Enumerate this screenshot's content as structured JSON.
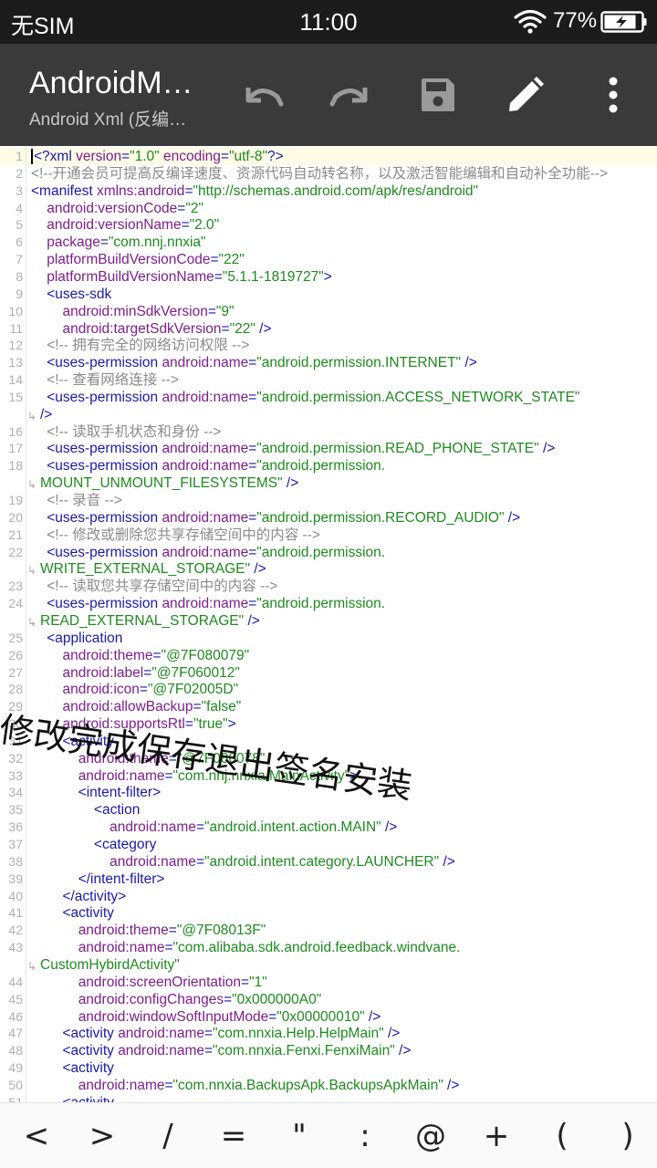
{
  "status_bar": {
    "carrier": "无SIM",
    "time": "11:00",
    "battery_percent": "77%"
  },
  "toolbar": {
    "title": "AndroidM…",
    "subtitle": "Android Xml (反编…",
    "icons": [
      "undo-icon",
      "redo-icon",
      "save-icon",
      "edit-icon",
      "more-icon"
    ]
  },
  "editor": {
    "lines": [
      {
        "n": "1",
        "segs": [
          [
            "t",
            "<?xml "
          ],
          [
            "a",
            "version"
          ],
          [
            "t",
            "="
          ],
          [
            "v",
            "\"1.0\""
          ],
          [
            "t",
            " "
          ],
          [
            "a",
            "encoding"
          ],
          [
            "t",
            "="
          ],
          [
            "v",
            "\"utf-8\""
          ],
          [
            "t",
            "?>"
          ]
        ]
      },
      {
        "n": "2",
        "segs": [
          [
            "c",
            "<!--开通会员可提高反编译速度、资源代码自动转名称，以及激活智能编辑和自动补全功能-->"
          ]
        ]
      },
      {
        "n": "3",
        "segs": [
          [
            "t",
            "<manifest "
          ],
          [
            "a",
            "xmlns:android"
          ],
          [
            "t",
            "="
          ],
          [
            "v",
            "\"http://schemas.android.com/apk/res/android\""
          ]
        ]
      },
      {
        "n": "4",
        "segs": [
          [
            "t",
            "    "
          ],
          [
            "a",
            "android:versionCode"
          ],
          [
            "t",
            "="
          ],
          [
            "v",
            "\"2\""
          ]
        ]
      },
      {
        "n": "5",
        "segs": [
          [
            "t",
            "    "
          ],
          [
            "a",
            "android:versionName"
          ],
          [
            "t",
            "="
          ],
          [
            "v",
            "\"2.0\""
          ]
        ]
      },
      {
        "n": "6",
        "segs": [
          [
            "t",
            "    "
          ],
          [
            "a",
            "package"
          ],
          [
            "t",
            "="
          ],
          [
            "v",
            "\"com.nnj.nnxia\""
          ]
        ]
      },
      {
        "n": "7",
        "segs": [
          [
            "t",
            "    "
          ],
          [
            "a",
            "platformBuildVersionCode"
          ],
          [
            "t",
            "="
          ],
          [
            "v",
            "\"22\""
          ]
        ]
      },
      {
        "n": "8",
        "segs": [
          [
            "t",
            "    "
          ],
          [
            "a",
            "platformBuildVersionName"
          ],
          [
            "t",
            "="
          ],
          [
            "v",
            "\"5.1.1-1819727\""
          ],
          [
            "t",
            ">"
          ]
        ]
      },
      {
        "n": "9",
        "segs": [
          [
            "t",
            "    <uses-sdk"
          ]
        ]
      },
      {
        "n": "10",
        "segs": [
          [
            "t",
            "        "
          ],
          [
            "a",
            "android:minSdkVersion"
          ],
          [
            "t",
            "="
          ],
          [
            "v",
            "\"9\""
          ]
        ]
      },
      {
        "n": "11",
        "segs": [
          [
            "t",
            "        "
          ],
          [
            "a",
            "android:targetSdkVersion"
          ],
          [
            "t",
            "="
          ],
          [
            "v",
            "\"22\""
          ],
          [
            "t",
            " />"
          ]
        ]
      },
      {
        "n": "12",
        "segs": [
          [
            "t",
            "    "
          ],
          [
            "c",
            "<!-- 拥有完全的网络访问权限 -->"
          ]
        ]
      },
      {
        "n": "13",
        "segs": [
          [
            "t",
            "    <uses-permission "
          ],
          [
            "a",
            "android:name"
          ],
          [
            "t",
            "="
          ],
          [
            "v",
            "\"android.permission.INTERNET\""
          ],
          [
            "t",
            " />"
          ]
        ]
      },
      {
        "n": "14",
        "segs": [
          [
            "t",
            "    "
          ],
          [
            "c",
            "<!-- 查看网络连接 -->"
          ]
        ]
      },
      {
        "n": "15",
        "segs": [
          [
            "t",
            "    <uses-permission "
          ],
          [
            "a",
            "android:name"
          ],
          [
            "t",
            "="
          ],
          [
            "v",
            "\"android.permission.ACCESS_NETWORK_STATE\""
          ]
        ]
      },
      {
        "n": "",
        "wrap": true,
        "segs": [
          [
            "t",
            "/>"
          ]
        ]
      },
      {
        "n": "16",
        "segs": [
          [
            "t",
            "    "
          ],
          [
            "c",
            "<!-- 读取手机状态和身份 -->"
          ]
        ]
      },
      {
        "n": "17",
        "segs": [
          [
            "t",
            "    <uses-permission "
          ],
          [
            "a",
            "android:name"
          ],
          [
            "t",
            "="
          ],
          [
            "v",
            "\"android.permission.READ_PHONE_STATE\""
          ],
          [
            "t",
            " />"
          ]
        ]
      },
      {
        "n": "18",
        "segs": [
          [
            "t",
            "    <uses-permission "
          ],
          [
            "a",
            "android:name"
          ],
          [
            "t",
            "="
          ],
          [
            "v",
            "\"android.permission."
          ]
        ]
      },
      {
        "n": "",
        "wrap": true,
        "segs": [
          [
            "v",
            "MOUNT_UNMOUNT_FILESYSTEMS\""
          ],
          [
            "t",
            " />"
          ]
        ]
      },
      {
        "n": "19",
        "segs": [
          [
            "t",
            "    "
          ],
          [
            "c",
            "<!-- 录音 -->"
          ]
        ]
      },
      {
        "n": "20",
        "segs": [
          [
            "t",
            "    <uses-permission "
          ],
          [
            "a",
            "android:name"
          ],
          [
            "t",
            "="
          ],
          [
            "v",
            "\"android.permission.RECORD_AUDIO\""
          ],
          [
            "t",
            " />"
          ]
        ]
      },
      {
        "n": "21",
        "segs": [
          [
            "t",
            "    "
          ],
          [
            "c",
            "<!-- 修改或删除您共享存储空间中的内容 -->"
          ]
        ]
      },
      {
        "n": "22",
        "segs": [
          [
            "t",
            "    <uses-permission "
          ],
          [
            "a",
            "android:name"
          ],
          [
            "t",
            "="
          ],
          [
            "v",
            "\"android.permission."
          ]
        ]
      },
      {
        "n": "",
        "wrap": true,
        "segs": [
          [
            "v",
            "WRITE_EXTERNAL_STORAGE\""
          ],
          [
            "t",
            " />"
          ]
        ]
      },
      {
        "n": "23",
        "segs": [
          [
            "t",
            "    "
          ],
          [
            "c",
            "<!-- 读取您共享存储空间中的内容 -->"
          ]
        ]
      },
      {
        "n": "24",
        "segs": [
          [
            "t",
            "    <uses-permission "
          ],
          [
            "a",
            "android:name"
          ],
          [
            "t",
            "="
          ],
          [
            "v",
            "\"android.permission."
          ]
        ]
      },
      {
        "n": "",
        "wrap": true,
        "segs": [
          [
            "v",
            "READ_EXTERNAL_STORAGE\""
          ],
          [
            "t",
            " />"
          ]
        ]
      },
      {
        "n": "25",
        "segs": [
          [
            "t",
            "    <application"
          ]
        ]
      },
      {
        "n": "26",
        "segs": [
          [
            "t",
            "        "
          ],
          [
            "a",
            "android:theme"
          ],
          [
            "t",
            "="
          ],
          [
            "v",
            "\"@7F080079\""
          ]
        ]
      },
      {
        "n": "27",
        "segs": [
          [
            "t",
            "        "
          ],
          [
            "a",
            "android:label"
          ],
          [
            "t",
            "="
          ],
          [
            "v",
            "\"@7F060012\""
          ]
        ]
      },
      {
        "n": "28",
        "segs": [
          [
            "t",
            "        "
          ],
          [
            "a",
            "android:icon"
          ],
          [
            "t",
            "="
          ],
          [
            "v",
            "\"@7F02005D\""
          ]
        ]
      },
      {
        "n": "29",
        "segs": [
          [
            "t",
            "        "
          ],
          [
            "a",
            "android:allowBackup"
          ],
          [
            "t",
            "="
          ],
          [
            "v",
            "\"false\""
          ]
        ]
      },
      {
        "n": "30",
        "segs": [
          [
            "t",
            "        "
          ],
          [
            "a",
            "android:supportsRtl"
          ],
          [
            "t",
            "="
          ],
          [
            "v",
            "\"true\""
          ],
          [
            "t",
            ">"
          ]
        ]
      },
      {
        "n": "31",
        "segs": [
          [
            "t",
            "        <activity"
          ]
        ]
      },
      {
        "n": "32",
        "segs": [
          [
            "t",
            "            "
          ],
          [
            "a",
            "android:theme"
          ],
          [
            "t",
            "="
          ],
          [
            "v",
            "\"@7F080078\""
          ]
        ]
      },
      {
        "n": "33",
        "segs": [
          [
            "t",
            "            "
          ],
          [
            "a",
            "android:name"
          ],
          [
            "t",
            "="
          ],
          [
            "v",
            "\"com.nnj.nnxia.MainActivity\""
          ],
          [
            "t",
            ">"
          ]
        ]
      },
      {
        "n": "34",
        "segs": [
          [
            "t",
            "            <intent-filter>"
          ]
        ]
      },
      {
        "n": "35",
        "segs": [
          [
            "t",
            "                <action"
          ]
        ]
      },
      {
        "n": "36",
        "segs": [
          [
            "t",
            "                    "
          ],
          [
            "a",
            "android:name"
          ],
          [
            "t",
            "="
          ],
          [
            "v",
            "\"android.intent.action.MAIN\""
          ],
          [
            "t",
            " />"
          ]
        ]
      },
      {
        "n": "37",
        "segs": [
          [
            "t",
            "                <category"
          ]
        ]
      },
      {
        "n": "38",
        "segs": [
          [
            "t",
            "                    "
          ],
          [
            "a",
            "android:name"
          ],
          [
            "t",
            "="
          ],
          [
            "v",
            "\"android.intent.category.LAUNCHER\""
          ],
          [
            "t",
            " />"
          ]
        ]
      },
      {
        "n": "39",
        "segs": [
          [
            "t",
            "            </intent-filter>"
          ]
        ]
      },
      {
        "n": "40",
        "segs": [
          [
            "t",
            "        </activity>"
          ]
        ]
      },
      {
        "n": "41",
        "segs": [
          [
            "t",
            "        <activity"
          ]
        ]
      },
      {
        "n": "42",
        "segs": [
          [
            "t",
            "            "
          ],
          [
            "a",
            "android:theme"
          ],
          [
            "t",
            "="
          ],
          [
            "v",
            "\"@7F08013F\""
          ]
        ]
      },
      {
        "n": "43",
        "segs": [
          [
            "t",
            "            "
          ],
          [
            "a",
            "android:name"
          ],
          [
            "t",
            "="
          ],
          [
            "v",
            "\"com.alibaba.sdk.android.feedback.windvane."
          ]
        ]
      },
      {
        "n": "",
        "wrap": true,
        "segs": [
          [
            "v",
            "CustomHybirdActivity\""
          ]
        ]
      },
      {
        "n": "44",
        "segs": [
          [
            "t",
            "            "
          ],
          [
            "a",
            "android:screenOrientation"
          ],
          [
            "t",
            "="
          ],
          [
            "v",
            "\"1\""
          ]
        ]
      },
      {
        "n": "45",
        "segs": [
          [
            "t",
            "            "
          ],
          [
            "a",
            "android:configChanges"
          ],
          [
            "t",
            "="
          ],
          [
            "v",
            "\"0x000000A0\""
          ]
        ]
      },
      {
        "n": "46",
        "segs": [
          [
            "t",
            "            "
          ],
          [
            "a",
            "android:windowSoftInputMode"
          ],
          [
            "t",
            "="
          ],
          [
            "v",
            "\"0x00000010\""
          ],
          [
            "t",
            " />"
          ]
        ]
      },
      {
        "n": "47",
        "segs": [
          [
            "t",
            "        <activity "
          ],
          [
            "a",
            "android:name"
          ],
          [
            "t",
            "="
          ],
          [
            "v",
            "\"com.nnxia.Help.HelpMain\""
          ],
          [
            "t",
            " />"
          ]
        ]
      },
      {
        "n": "48",
        "segs": [
          [
            "t",
            "        <activity "
          ],
          [
            "a",
            "android:name"
          ],
          [
            "t",
            "="
          ],
          [
            "v",
            "\"com.nnxia.Fenxi.FenxiMain\""
          ],
          [
            "t",
            " />"
          ]
        ]
      },
      {
        "n": "49",
        "segs": [
          [
            "t",
            "        <activity"
          ]
        ]
      },
      {
        "n": "50",
        "segs": [
          [
            "t",
            "            "
          ],
          [
            "a",
            "android:name"
          ],
          [
            "t",
            "="
          ],
          [
            "v",
            "\"com.nnxia.BackupsApk.BackupsApkMain\""
          ],
          [
            "t",
            " />"
          ]
        ]
      },
      {
        "n": "51",
        "segs": [
          [
            "t",
            "        <activity"
          ]
        ]
      }
    ]
  },
  "overlay_text": "修改完成保存退出签名安装",
  "symbol_bar": {
    "keys": [
      "<",
      ">",
      "/",
      "=",
      "\"",
      ":",
      "@",
      "+",
      "(",
      ")"
    ]
  }
}
